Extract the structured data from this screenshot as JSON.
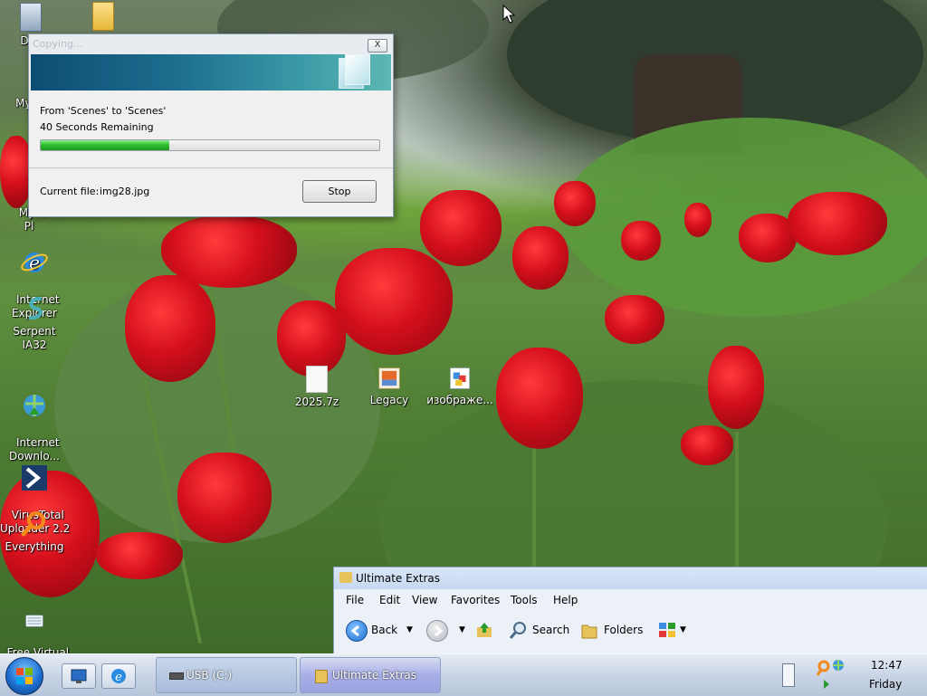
{
  "desktop": {
    "icons": [
      {
        "label": "Doc"
      },
      {
        "label": "My C"
      },
      {
        "label": "My N\nPl"
      },
      {
        "label": "Internet\nExplorer"
      },
      {
        "label": "Serpent IA32"
      },
      {
        "label": "Internet\nDownlo..."
      },
      {
        "label": "VirusTotal\nUploader 2.2"
      },
      {
        "label": "Everything"
      },
      {
        "label": "Free Virtual\nKeyboard"
      },
      {
        "label": "2025.7z"
      },
      {
        "label": "Legacy"
      },
      {
        "label": "изображе..."
      }
    ]
  },
  "copy_dialog": {
    "title": "Copying...",
    "close_label": "X",
    "from_text": "From 'Scenes' to 'Scenes'",
    "remaining_text": "40 Seconds Remaining",
    "progress_fraction": 0.38,
    "current_file_label": "Current file:",
    "current_file_value": "img28.jpg",
    "stop_label": "Stop"
  },
  "explorer": {
    "title": "Ultimate Extras",
    "menu": [
      "File",
      "Edit",
      "View",
      "Favorites",
      "Tools",
      "Help"
    ],
    "toolbar": {
      "back_label": "Back",
      "search_label": "Search",
      "folders_label": "Folders"
    }
  },
  "taskbar": {
    "tasks": [
      {
        "label": "USB (C:)"
      },
      {
        "label": "Ultimate Extras"
      }
    ],
    "clock_time": "12:47",
    "clock_day": "Friday"
  },
  "colors": {
    "progress": "#2fbf2f",
    "tulip_red": "#d40f1c",
    "taskbar": "#c9d5e6"
  }
}
